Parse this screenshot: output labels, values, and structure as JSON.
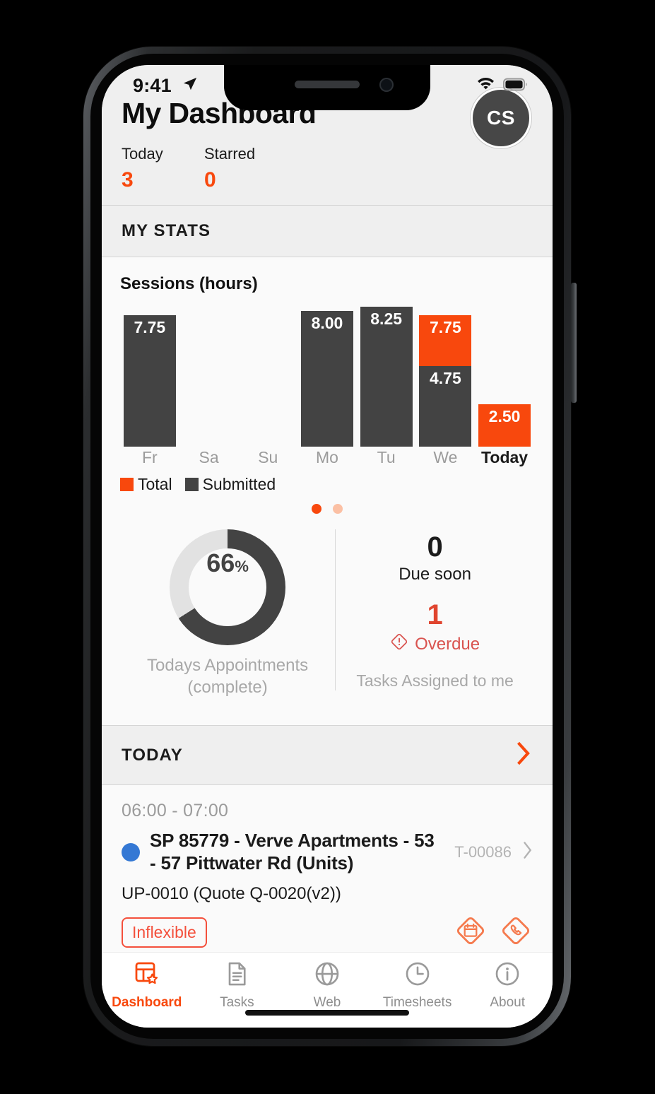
{
  "status_bar": {
    "time": "9:41",
    "location_icon": "location-arrow-icon",
    "wifi_icon": "wifi-icon",
    "battery_icon": "battery-full-icon"
  },
  "header": {
    "title": "My Dashboard",
    "avatar_initials": "CS",
    "counters": [
      {
        "label": "Today",
        "value": "3"
      },
      {
        "label": "Starred",
        "value": "0"
      }
    ]
  },
  "stats_section": {
    "header": "MY STATS",
    "legend": [
      {
        "label": "Total",
        "color": "#f8480d"
      },
      {
        "label": "Submitted",
        "color": "#434343"
      }
    ],
    "pagination": {
      "count": 2,
      "active": 1
    }
  },
  "chart_data": {
    "type": "bar",
    "title": "Sessions (hours)",
    "xlabel": "",
    "ylabel": "hours",
    "ylim": [
      0,
      8.25
    ],
    "grid": false,
    "stacked": true,
    "legend_position": "bottom-left",
    "categories": [
      "Fr",
      "Sa",
      "Su",
      "Mo",
      "Tu",
      "We",
      "Today"
    ],
    "series": [
      {
        "name": "Total",
        "color": "#f8480d",
        "values": [
          null,
          null,
          null,
          null,
          null,
          7.75,
          2.5
        ]
      },
      {
        "name": "Submitted",
        "color": "#434343",
        "values": [
          7.75,
          null,
          null,
          8.0,
          8.25,
          4.75,
          null
        ]
      }
    ],
    "bar_labels": [
      {
        "category": "Fr",
        "segments": [
          {
            "series": "Submitted",
            "label": "7.75",
            "value": 7.75
          }
        ]
      },
      {
        "category": "Sa",
        "segments": []
      },
      {
        "category": "Su",
        "segments": []
      },
      {
        "category": "Mo",
        "segments": [
          {
            "series": "Submitted",
            "label": "8.00",
            "value": 8.0
          }
        ]
      },
      {
        "category": "Tu",
        "segments": [
          {
            "series": "Submitted",
            "label": "8.25",
            "value": 8.25
          }
        ]
      },
      {
        "category": "We",
        "segments": [
          {
            "series": "Total",
            "label": "7.75",
            "value": 7.75
          },
          {
            "series": "Submitted",
            "label": "4.75",
            "value": 4.75
          }
        ]
      },
      {
        "category": "Today",
        "segments": [
          {
            "series": "Total",
            "label": "2.50",
            "value": 2.5
          }
        ]
      }
    ],
    "highlighted_category": "Today"
  },
  "donut": {
    "percent_value": "66",
    "percent_symbol": "%",
    "fraction": 0.66,
    "caption": "Todays Appointments (complete)",
    "fill_color": "#434343",
    "track_color": "#e2e2e2"
  },
  "tasks": {
    "due_soon_count": "0",
    "due_soon_label": "Due soon",
    "overdue_count": "1",
    "overdue_label": "Overdue",
    "footer": "Tasks Assigned to me"
  },
  "today_section": {
    "header": "TODAY",
    "chevron_icon": "chevron-right-icon",
    "appointment": {
      "time_range": "06:00 - 07:00",
      "title": "SP 85779 - Verve Apartments - 53 - 57 Pittwater Rd (Units)",
      "reference": "T-00086",
      "subtitle": "UP-0010 (Quote Q-0020(v2))",
      "badge": "Inflexible",
      "status_dot_color": "#3478d4",
      "actions": [
        "calendar-diamond-icon",
        "phone-diamond-icon"
      ]
    }
  },
  "tab_bar": {
    "items": [
      {
        "label": "Dashboard",
        "icon": "dashboard-star-icon",
        "active": true
      },
      {
        "label": "Tasks",
        "icon": "document-icon",
        "active": false
      },
      {
        "label": "Web",
        "icon": "globe-icon",
        "active": false
      },
      {
        "label": "Timesheets",
        "icon": "clock-icon",
        "active": false
      },
      {
        "label": "About",
        "icon": "info-circle-icon",
        "active": false
      }
    ]
  },
  "colors": {
    "accent": "#f8480d",
    "dark": "#434343",
    "red": "#d9534f",
    "blue": "#3478d4"
  }
}
